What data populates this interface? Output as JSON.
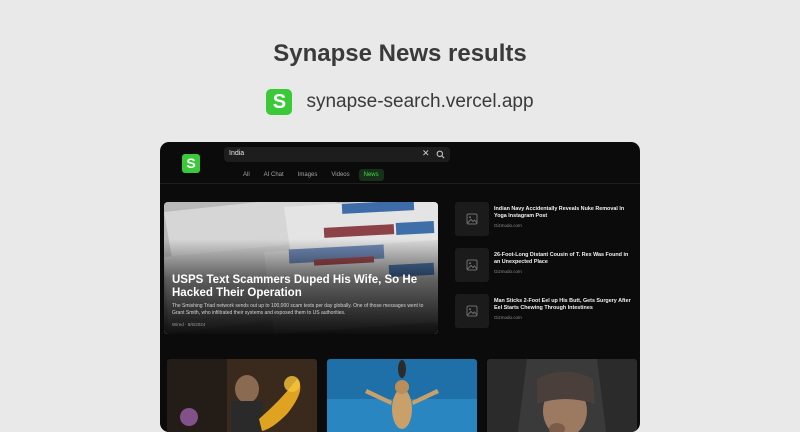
{
  "header": {
    "title": "Synapse News results",
    "logo_letter": "S",
    "site_url": "synapse-search.vercel.app"
  },
  "app": {
    "logo_letter": "S",
    "search": {
      "value": "India",
      "clear_symbol": "✕"
    },
    "tabs": [
      {
        "label": "All",
        "active": false
      },
      {
        "label": "AI Chat",
        "active": false
      },
      {
        "label": "Images",
        "active": false
      },
      {
        "label": "Videos",
        "active": false
      },
      {
        "label": "News",
        "active": true
      }
    ]
  },
  "featured": {
    "title": "USPS Text Scammers Duped His Wife, So He Hacked Their Operation",
    "description": "The Smishing Triad network sends out up to 100,000 scam texts per day globally. One of those messages went to Grant Smith, who infiltrated their systems and exposed them to US authorities.",
    "meta": "Wired · 8/6/2024"
  },
  "side_articles": [
    {
      "title": "Indian Navy Accidentally Reveals Nuke Removal In Yoga Instagram Post",
      "source": "Gizmodo.com",
      "icon": "image-placeholder-icon"
    },
    {
      "title": "26-Foot-Long Distant Cousin of T. Rex Was Found in an Unexpected Place",
      "source": "Gizmodo.com",
      "icon": "image-placeholder-icon"
    },
    {
      "title": "Man Sticks 2-Foot Eel up His Butt, Gets Surgery After Eel Starts Chewing Through Intestines",
      "source": "Gizmodo.com",
      "icon": "image-placeholder-icon"
    }
  ],
  "colors": {
    "page_background": "#e9e9e9",
    "app_background": "#0b0b0b",
    "brand_green": "#3bc93a",
    "active_tab_text": "#4cd34b"
  }
}
